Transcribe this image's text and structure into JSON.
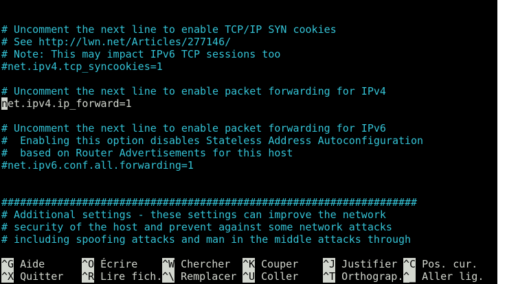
{
  "editor": {
    "lines": [
      "# Uncomment the next line to enable TCP/IP SYN cookies",
      "# See http://lwn.net/Articles/277146/",
      "# Note: This may impact IPv6 TCP sessions too",
      "#net.ipv4.tcp_syncookies=1",
      "",
      "# Uncomment the next line to enable packet forwarding for IPv4",
      "et.ipv4.ip_forward=1",
      "",
      "# Uncomment the next line to enable packet forwarding for IPv6",
      "#  Enabling this option disables Stateless Address Autoconfiguration",
      "#  based on Router Advertisements for this host",
      "#net.ipv6.conf.all.forwarding=1",
      "",
      "",
      "###################################################################",
      "# Additional settings - these settings can improve the network",
      "# security of the host and prevent against some network attacks",
      "# including spoofing attacks and man in the middle attacks through"
    ],
    "cursor_char": "n"
  },
  "shortcuts": {
    "row1": [
      {
        "key": "^G",
        "label": "Aide"
      },
      {
        "key": "^O",
        "label": "Écrire"
      },
      {
        "key": "^W",
        "label": "Chercher"
      },
      {
        "key": "^K",
        "label": "Couper"
      },
      {
        "key": "^J",
        "label": "Justifier"
      },
      {
        "key": "^C",
        "label": "Pos. cur."
      }
    ],
    "row2": [
      {
        "key": "^X",
        "label": "Quitter"
      },
      {
        "key": "^R",
        "label": "Lire fich."
      },
      {
        "key": "^\\",
        "label": "Remplacer"
      },
      {
        "key": "^U",
        "label": "Coller"
      },
      {
        "key": "^T",
        "label": "Orthograp."
      },
      {
        "key": "^_",
        "label": "Aller lig."
      }
    ]
  },
  "colors": {
    "background": "#000000",
    "comment": "#34c3d6",
    "text": "#d3d7cf"
  }
}
